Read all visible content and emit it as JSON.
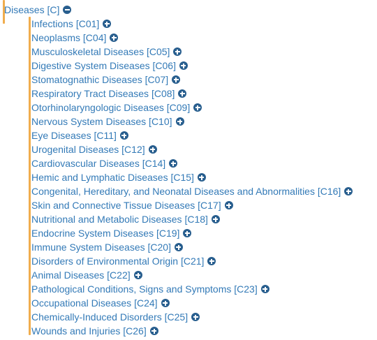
{
  "tree": {
    "previous_sibling_clipped": "",
    "root": {
      "label": "Diseases [C]",
      "state": "collapse",
      "icon": "minus-circle-icon"
    },
    "children": [
      {
        "label": "Infections [C01]"
      },
      {
        "label": "Neoplasms [C04]"
      },
      {
        "label": "Musculoskeletal Diseases [C05]"
      },
      {
        "label": "Digestive System Diseases [C06]"
      },
      {
        "label": "Stomatognathic Diseases [C07]"
      },
      {
        "label": "Respiratory Tract Diseases [C08]"
      },
      {
        "label": "Otorhinolaryngologic Diseases [C09]"
      },
      {
        "label": "Nervous System Diseases [C10]"
      },
      {
        "label": "Eye Diseases [C11]"
      },
      {
        "label": "Urogenital Diseases [C12]"
      },
      {
        "label": "Cardiovascular Diseases [C14]"
      },
      {
        "label": "Hemic and Lymphatic Diseases [C15]"
      },
      {
        "label": "Congenital, Hereditary, and Neonatal Diseases and Abnormalities [C16]"
      },
      {
        "label": "Skin and Connective Tissue Diseases [C17]"
      },
      {
        "label": "Nutritional and Metabolic Diseases [C18]"
      },
      {
        "label": "Endocrine System Diseases [C19]"
      },
      {
        "label": "Immune System Diseases [C20]"
      },
      {
        "label": "Disorders of Environmental Origin [C21]"
      },
      {
        "label": "Animal Diseases [C22]"
      },
      {
        "label": "Pathological Conditions, Signs and Symptoms [C23]"
      },
      {
        "label": "Occupational Diseases [C24]"
      },
      {
        "label": "Chemically-Induced Disorders [C25]"
      },
      {
        "label": "Wounds and Injuries [C26]"
      }
    ],
    "child_icon": "plus-circle-icon"
  },
  "colors": {
    "link": "#337ab7",
    "toggle": "#285e8e",
    "tree_line": "#f0ad4e",
    "background": "#ffffff"
  }
}
